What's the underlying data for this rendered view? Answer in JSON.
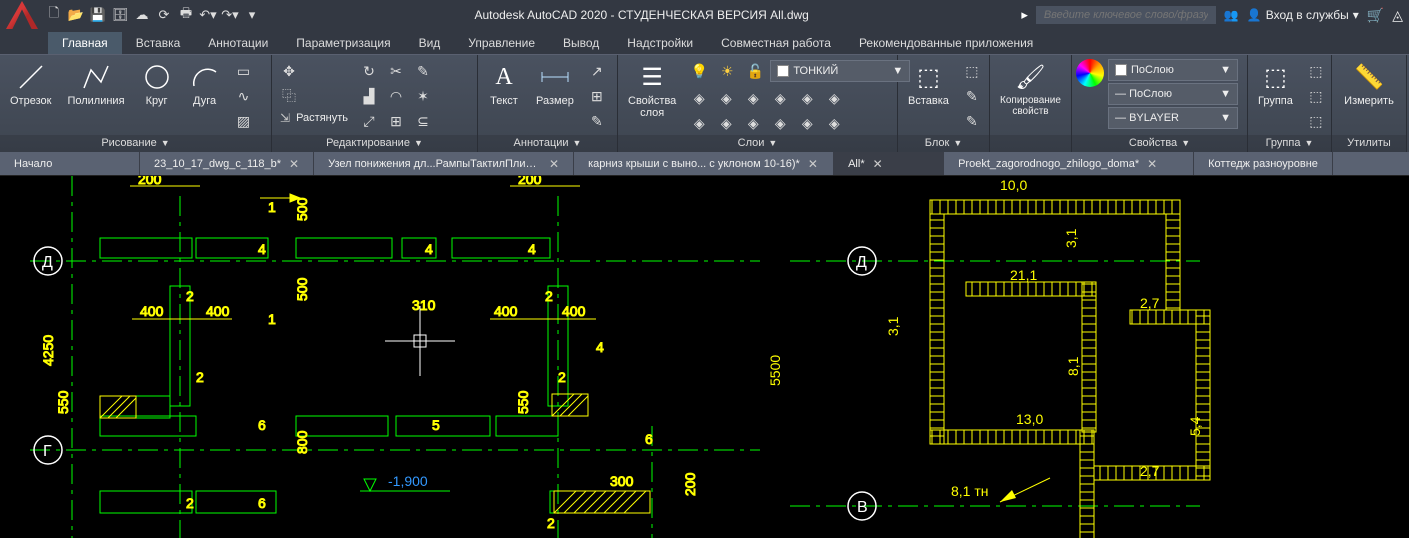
{
  "app": {
    "title_full": "Autodesk AutoCAD 2020 - СТУДЕНЧЕСКАЯ ВЕРСИЯ   All.dwg",
    "search_placeholder": "Введите ключевое слово/фразу",
    "signin_label": "Вход в службы"
  },
  "qat_icons": [
    "new",
    "open",
    "save",
    "saveall",
    "autosave",
    "undo-sync",
    "print",
    "undo",
    "redo"
  ],
  "menutabs": {
    "items": [
      "Главная",
      "Вставка",
      "Аннотации",
      "Параметризация",
      "Вид",
      "Управление",
      "Вывод",
      "Надстройки",
      "Совместная работа",
      "Рекомендованные приложения"
    ],
    "active": 0
  },
  "ribbon": {
    "draw": {
      "title": "Рисование",
      "big": [
        {
          "label": "Отрезок"
        },
        {
          "label": "Полилиния"
        },
        {
          "label": "Круг"
        },
        {
          "label": "Дуга"
        }
      ]
    },
    "edit": {
      "title": "Редактирование",
      "stretch_label": "Растянуть"
    },
    "annot": {
      "title": "Аннотации",
      "text_label": "Текст",
      "dim_label": "Размер"
    },
    "layers": {
      "title": "Слои",
      "props_label": "Свойства\nслоя",
      "combo_value": "ТОНКИЙ"
    },
    "insert": {
      "title": "Блок",
      "label": "Вставка"
    },
    "copyprops": {
      "title": "",
      "label": "Копирование\nсвойств"
    },
    "props": {
      "title": "Свойства",
      "combo1": "ПоСлою",
      "combo2": "ПоСлою",
      "combo3": "BYLAYER"
    },
    "group": {
      "title": "Группа",
      "label": "Группа"
    },
    "measure": {
      "title": "Утилиты",
      "label": "Измерить"
    }
  },
  "doctabs": {
    "items": [
      {
        "label": "Начало",
        "closable": false
      },
      {
        "label": "23_10_17_dwg_c_118_b*",
        "closable": true
      },
      {
        "label": "Узел понижения дл...РампыТактилПлиты*",
        "closable": true
      },
      {
        "label": "карниз крыши с выно... с уклоном 10-16)*",
        "closable": true
      },
      {
        "label": "All*",
        "closable": true,
        "active": true
      },
      {
        "label": "Proekt_zagorodnogo_zhilogo_doma*",
        "closable": true
      },
      {
        "label": "Коттедж разноуровне",
        "closable": false
      }
    ]
  },
  "drawing": {
    "axis_labels": [
      "Д",
      "Г",
      "Д",
      "В"
    ],
    "dims_left": [
      "200",
      "500",
      "4",
      "4",
      "4",
      "1",
      "200",
      "500",
      "310",
      "2",
      "2",
      "400",
      "400",
      "400",
      "400",
      "1",
      "4250",
      "550",
      "800",
      "550",
      "2",
      "2",
      "6",
      "5",
      "6",
      "300",
      "200",
      "6",
      "2",
      "-1,900",
      "4"
    ],
    "dims_right": [
      "10,0",
      "3,1",
      "21,1",
      "3,1",
      "2,7",
      "8,1",
      "13,0",
      "5,4",
      "2,7",
      "8,1 тн",
      "5500"
    ],
    "elevation": "-1,900"
  }
}
